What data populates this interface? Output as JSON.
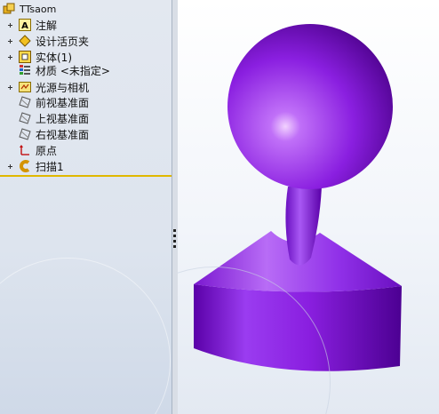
{
  "tree": {
    "root": "TTsaom",
    "items": [
      {
        "label": "注解",
        "icon": "annotation-icon"
      },
      {
        "label": "设计活页夹",
        "icon": "design-binder-icon"
      },
      {
        "label": "实体(1)",
        "icon": "solid-bodies-icon"
      },
      {
        "label": "材质 <未指定>",
        "icon": "material-icon"
      },
      {
        "label": "光源与相机",
        "icon": "lights-cameras-icon"
      },
      {
        "label": "前视基准面",
        "icon": "plane-icon"
      },
      {
        "label": "上视基准面",
        "icon": "plane-icon"
      },
      {
        "label": "右视基准面",
        "icon": "plane-icon"
      },
      {
        "label": "原点",
        "icon": "origin-icon"
      },
      {
        "label": "扫描1",
        "icon": "sweep-feature-icon"
      }
    ]
  },
  "colors": {
    "model": "#8a1fe0",
    "rollback_bar": "#e0b800",
    "panel_bg": "#dfe6ef"
  }
}
